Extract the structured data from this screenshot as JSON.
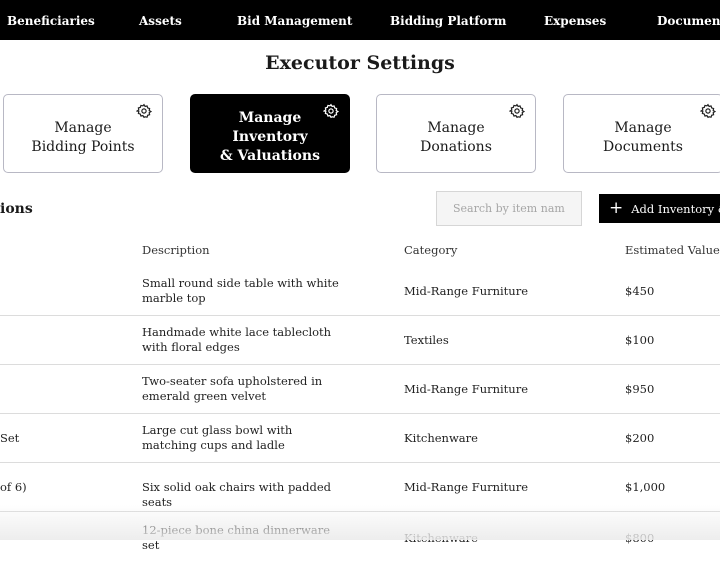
{
  "nav": {
    "items": [
      "Beneficiaries",
      "Assets",
      "Bid Management",
      "Bidding Platform",
      "Expenses",
      "Documents"
    ]
  },
  "page": {
    "title": "Executor Settings"
  },
  "cards": [
    {
      "label": "Manage\nBidding Points",
      "icon": "gear-icon",
      "active": false
    },
    {
      "label": "Manage Inventory\n& Valuations",
      "icon": "gear-icon",
      "active": true
    },
    {
      "label": "Manage\nDonations",
      "icon": "gear-icon",
      "active": false
    },
    {
      "label": "Manage\nDocuments",
      "icon": "gear-icon",
      "active": false
    }
  ],
  "section": {
    "title": "ions",
    "search_placeholder": "Search by item name..",
    "add_label": "Add Inventory & V"
  },
  "table": {
    "headers": [
      "Description",
      "Category",
      "Estimated Value"
    ],
    "rows": [
      {
        "name": "",
        "description": "Small round side table with white marble top",
        "category": "Mid-Range Furniture",
        "value": "$450"
      },
      {
        "name": "",
        "description": "Handmade white lace tablecloth with floral edges",
        "category": "Textiles",
        "value": "$100"
      },
      {
        "name": "",
        "description": "Two-seater sofa upholstered in emerald green velvet",
        "category": "Mid-Range Furniture",
        "value": "$950"
      },
      {
        "name": "Set",
        "description": "Large cut glass bowl with matching cups and ladle",
        "category": "Kitchenware",
        "value": "$200"
      },
      {
        "name": "of 6)",
        "description": "Six solid oak chairs with padded seats",
        "category": "Mid-Range Furniture",
        "value": "$1,000"
      },
      {
        "name": "",
        "description": "12-piece bone china dinnerware set",
        "category": "Kitchenware",
        "value": "$800"
      }
    ]
  }
}
